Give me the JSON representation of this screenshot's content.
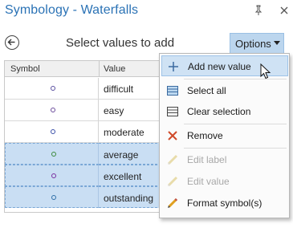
{
  "pane": {
    "title": "Symbology - Waterfalls",
    "pin_icon": "pin-icon",
    "close_icon": "close-icon"
  },
  "toolbar": {
    "title": "Select values to add",
    "back_icon": "back-arrow-icon",
    "options_label": "Options"
  },
  "grid": {
    "columns": [
      "Symbol",
      "Value"
    ],
    "rows": [
      {
        "value": "difficult",
        "selected": false,
        "dot_color": "#5a4fa0"
      },
      {
        "value": "easy",
        "selected": false,
        "dot_color": "#6a4a9a"
      },
      {
        "value": "moderate",
        "selected": false,
        "dot_color": "#3a4fa8"
      },
      {
        "value": "average",
        "selected": true,
        "dot_color": "#3c8a3a"
      },
      {
        "value": "excellent",
        "selected": true,
        "dot_color": "#7a2fa0"
      },
      {
        "value": "outstanding",
        "selected": true,
        "dot_color": "#2f6fa8"
      }
    ]
  },
  "menu": {
    "items": [
      {
        "label": "Add new value",
        "icon": "plus-icon",
        "enabled": true,
        "hover": true
      },
      {
        "label": "Select all",
        "icon": "select-all-icon",
        "enabled": true,
        "hover": false
      },
      {
        "label": "Clear selection",
        "icon": "clear-selection-icon",
        "enabled": true,
        "hover": false
      },
      {
        "label": "Remove",
        "icon": "remove-x-icon",
        "enabled": true,
        "hover": false
      },
      {
        "label": "Edit label",
        "icon": "pencil-icon",
        "enabled": false,
        "hover": false
      },
      {
        "label": "Edit value",
        "icon": "pencil-icon",
        "enabled": false,
        "hover": false
      },
      {
        "label": "Format symbol(s)",
        "icon": "format-pencil-icon",
        "enabled": true,
        "hover": false
      }
    ]
  },
  "colors": {
    "title_blue": "#2a72b5",
    "selection": "#c9def3",
    "options_button": "#bcd6ee",
    "remove_red": "#d04a2a"
  }
}
